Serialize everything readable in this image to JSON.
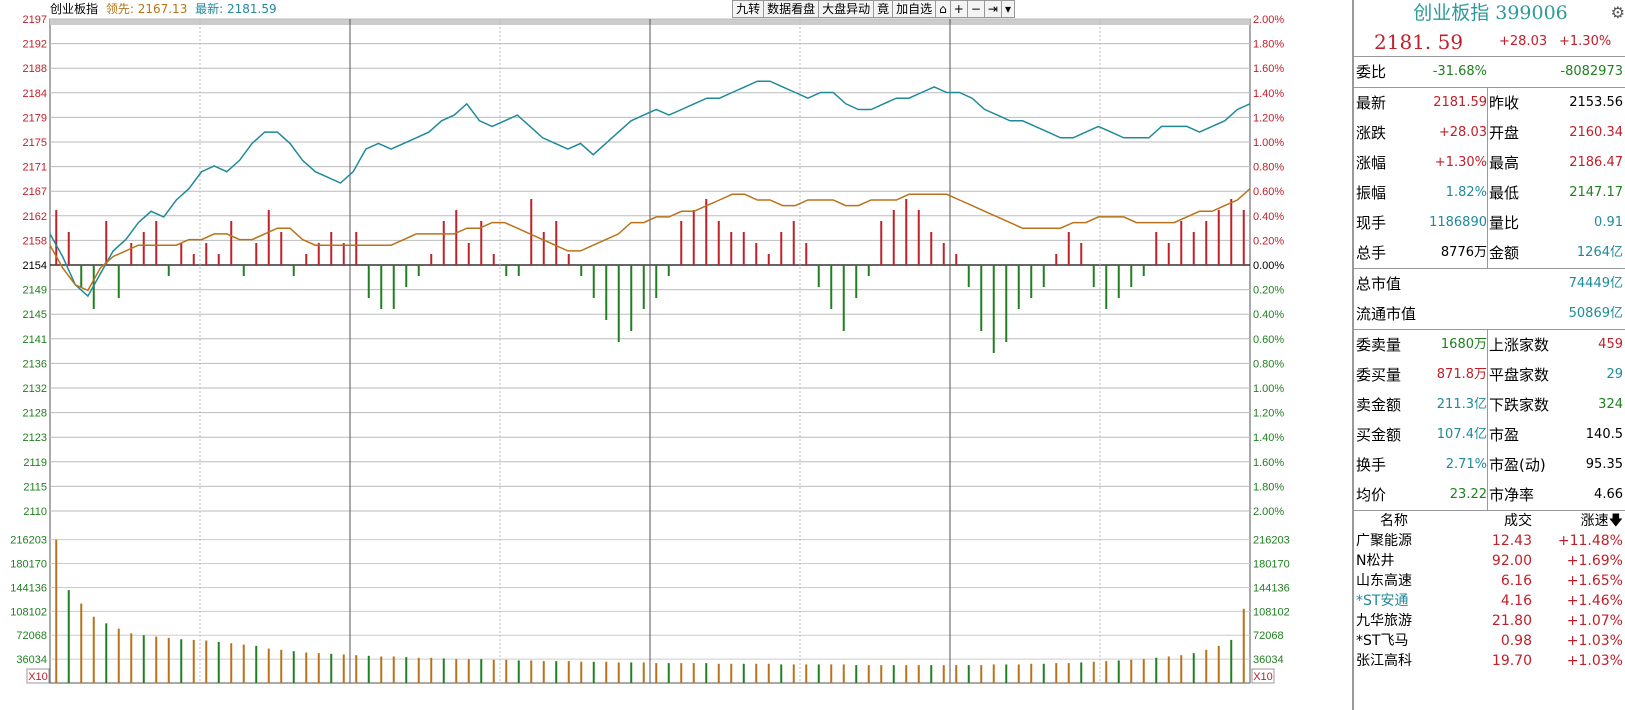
{
  "header": {
    "index_name": "创业板指",
    "lead_label": "领先: 2167.13",
    "latest_label": "最新: 2181.59"
  },
  "toolbar": {
    "items": [
      "九转",
      "数据看盘",
      "大盘异动",
      "竟",
      "加自选",
      "⌂",
      "+",
      "−",
      "⇥",
      "▾"
    ]
  },
  "price_axis": {
    "left_labels": [
      "2197",
      "2192",
      "2188",
      "2184",
      "2179",
      "2175",
      "2171",
      "2167",
      "2162",
      "2158",
      "2154",
      "2149",
      "2145",
      "2141",
      "2136",
      "2132",
      "2128",
      "2123",
      "2119",
      "2115",
      "2110"
    ],
    "right_labels": [
      "2.00%",
      "1.80%",
      "1.60%",
      "1.40%",
      "1.20%",
      "1.00%",
      "0.80%",
      "0.60%",
      "0.40%",
      "0.20%",
      "0.00%",
      "0.20%",
      "0.40%",
      "0.60%",
      "0.80%",
      "1.00%",
      "1.20%",
      "1.40%",
      "1.60%",
      "1.80%",
      "2.00%"
    ]
  },
  "volume_axis": {
    "labels": [
      "216203",
      "180170",
      "144136",
      "108102",
      "72068",
      "36034"
    ],
    "unit_label": "X10"
  },
  "colors": {
    "up": "#c0202a",
    "down": "#208020",
    "index_line": "#1f8a9a",
    "lead_line": "#b8731a",
    "volume_up": "#b8731a",
    "volume_down": "#208020"
  },
  "chart_data": {
    "type": "line",
    "title": "",
    "series": [
      {
        "name": "最新",
        "values": [
          2159,
          2155,
          2150,
          2148,
          2152,
          2156,
          2158,
          2161,
          2163,
          2162,
          2165,
          2167,
          2170,
          2171,
          2170,
          2172,
          2175,
          2177,
          2177,
          2175,
          2172,
          2170,
          2169,
          2168,
          2170,
          2174,
          2175,
          2174,
          2175,
          2176,
          2177,
          2179,
          2180,
          2182,
          2179,
          2178,
          2179,
          2180,
          2178,
          2176,
          2175,
          2174,
          2175,
          2173,
          2175,
          2177,
          2179,
          2180,
          2181,
          2180,
          2181,
          2182,
          2183,
          2183,
          2184,
          2185,
          2186,
          2186,
          2185,
          2184,
          2183,
          2184,
          2184,
          2182,
          2181,
          2181,
          2182,
          2183,
          2183,
          2184,
          2185,
          2184,
          2184,
          2183,
          2181,
          2180,
          2179,
          2179,
          2178,
          2177,
          2176,
          2176,
          2177,
          2178,
          2177,
          2176,
          2176,
          2176,
          2178,
          2178,
          2178,
          2177,
          2178,
          2179,
          2181,
          2182
        ]
      },
      {
        "name": "领先",
        "values": [
          2157,
          2153,
          2150,
          2149,
          2153,
          2155,
          2156,
          2157,
          2157,
          2157,
          2157,
          2158,
          2158,
          2159,
          2159,
          2158,
          2158,
          2159,
          2160,
          2160,
          2158,
          2157,
          2157,
          2157,
          2157,
          2157,
          2157,
          2157,
          2158,
          2159,
          2159,
          2159,
          2159,
          2160,
          2160,
          2161,
          2161,
          2160,
          2159,
          2158,
          2157,
          2156,
          2156,
          2157,
          2158,
          2159,
          2161,
          2161,
          2162,
          2162,
          2163,
          2163,
          2164,
          2165,
          2166,
          2166,
          2165,
          2165,
          2164,
          2164,
          2165,
          2165,
          2165,
          2164,
          2164,
          2165,
          2165,
          2165,
          2166,
          2166,
          2166,
          2166,
          2165,
          2164,
          2163,
          2162,
          2161,
          2160,
          2160,
          2160,
          2160,
          2161,
          2161,
          2162,
          2162,
          2162,
          2161,
          2161,
          2161,
          2161,
          2162,
          2163,
          2163,
          2164,
          2165,
          2167
        ]
      }
    ],
    "bars": {
      "name": "涨跌力度",
      "values": [
        5,
        3,
        -2,
        -4,
        4,
        -3,
        2,
        3,
        4,
        -1,
        2,
        1,
        2,
        1,
        4,
        -1,
        2,
        5,
        3,
        -1,
        1,
        2,
        3,
        2,
        3,
        -3,
        -4,
        -4,
        -2,
        -1,
        1,
        4,
        5,
        2,
        4,
        1,
        -1,
        -1,
        6,
        3,
        4,
        1,
        -1,
        -3,
        -5,
        -7,
        -6,
        -4,
        -3,
        -1,
        4,
        5,
        6,
        4,
        3,
        3,
        2,
        1,
        3,
        4,
        2,
        -2,
        -4,
        -6,
        -3,
        -1,
        4,
        5,
        6,
        5,
        3,
        2,
        1,
        -2,
        -6,
        -8,
        -7,
        -4,
        -3,
        -2,
        1,
        3,
        2,
        -2,
        -4,
        -3,
        -2,
        -1,
        3,
        2,
        4,
        3,
        4,
        5,
        6,
        5
      ]
    },
    "volume": {
      "name": "成交量",
      "values": [
        216203,
        140000,
        120000,
        100000,
        90000,
        82000,
        75000,
        72000,
        70000,
        68000,
        66000,
        65000,
        64000,
        62000,
        60000,
        58000,
        56000,
        52000,
        50000,
        48000,
        46000,
        45000,
        44000,
        43000,
        42000,
        41000,
        40000,
        40000,
        39000,
        38000,
        38000,
        37000,
        36000,
        36000,
        36000,
        35000,
        35000,
        34000,
        34000,
        33000,
        33000,
        33000,
        32000,
        32000,
        32000,
        31000,
        31000,
        31000,
        30000,
        30000,
        30000,
        30000,
        30000,
        29000,
        29000,
        29000,
        29000,
        29000,
        28000,
        28000,
        28000,
        28000,
        28000,
        28000,
        27000,
        27000,
        27000,
        27000,
        27000,
        27000,
        27000,
        27000,
        27000,
        27000,
        27000,
        28000,
        28000,
        28000,
        29000,
        29000,
        30000,
        30000,
        31000,
        32000,
        33000,
        34000,
        35000,
        36000,
        38000,
        40000,
        42000,
        45000,
        50000,
        56000,
        65000,
        112000
      ]
    },
    "ylim": [
      2110,
      2197
    ]
  },
  "panel": {
    "title": "创业板指 399006",
    "gear_icon": "gear-icon",
    "price": "2181. 59",
    "change": "+28.03",
    "change_pct": "+1.30%",
    "weibi": {
      "label": "委比",
      "value": "-31.68%",
      "value2": "-8082973"
    },
    "stats": [
      {
        "l1": "最新",
        "v1": "2181.59",
        "c1": "red",
        "l2": "昨收",
        "v2": "2153.56",
        "c2": "blk"
      },
      {
        "l1": "涨跌",
        "v1": "+28.03",
        "c1": "red",
        "l2": "开盘",
        "v2": "2160.34",
        "c2": "red"
      },
      {
        "l1": "涨幅",
        "v1": "+1.30%",
        "c1": "red",
        "l2": "最高",
        "v2": "2186.47",
        "c2": "red"
      },
      {
        "l1": "振幅",
        "v1": "1.82%",
        "c1": "teal",
        "l2": "最低",
        "v2": "2147.17",
        "c2": "green"
      },
      {
        "l1": "现手",
        "v1": "1186890",
        "c1": "teal",
        "l2": "量比",
        "v2": "0.91",
        "c2": "teal"
      },
      {
        "l1": "总手",
        "v1": "8776万",
        "c1": "blk",
        "l2": "金额",
        "v2": "1264亿",
        "c2": "teal"
      }
    ],
    "market": [
      {
        "label": "总市值",
        "value": "74449亿"
      },
      {
        "label": "流通市值",
        "value": "50869亿"
      }
    ],
    "orders": [
      {
        "l1": "委卖量",
        "v1": "1680万",
        "c1": "green",
        "l2": "上涨家数",
        "v2": "459",
        "c2": "red"
      },
      {
        "l1": "委买量",
        "v1": "871.8万",
        "c1": "red",
        "l2": "平盘家数",
        "v2": "29",
        "c2": "teal"
      },
      {
        "l1": "卖金额",
        "v1": "211.3亿",
        "c1": "teal",
        "l2": "下跌家数",
        "v2": "324",
        "c2": "green"
      },
      {
        "l1": "买金额",
        "v1": "107.4亿",
        "c1": "teal",
        "l2": "市盈",
        "v2": "140.5",
        "c2": "blk"
      },
      {
        "l1": "换手",
        "v1": "2.71%",
        "c1": "teal",
        "l2": "市盈(动)",
        "v2": "95.35",
        "c2": "blk"
      },
      {
        "l1": "均价",
        "v1": "23.22",
        "c1": "green",
        "l2": "市净率",
        "v2": "4.66",
        "c2": "blk"
      }
    ],
    "list_header": {
      "name": "名称",
      "price": "成交",
      "speed": "涨速"
    },
    "list": [
      {
        "name": "广聚能源",
        "price": "12.43",
        "speed": "+11.48%",
        "nc": "blk"
      },
      {
        "name": "N松井",
        "price": "92.00",
        "speed": "+1.69%",
        "nc": "blk"
      },
      {
        "name": "山东高速",
        "price": "6.16",
        "speed": "+1.65%",
        "nc": "blk"
      },
      {
        "name": "*ST安通",
        "price": "4.16",
        "speed": "+1.46%",
        "nc": "teal"
      },
      {
        "name": "九华旅游",
        "price": "21.80",
        "speed": "+1.07%",
        "nc": "blk"
      },
      {
        "name": "*ST飞马",
        "price": "0.98",
        "speed": "+1.03%",
        "nc": "blk"
      },
      {
        "name": "张江高科",
        "price": "19.70",
        "speed": "+1.03%",
        "nc": "blk"
      }
    ]
  }
}
